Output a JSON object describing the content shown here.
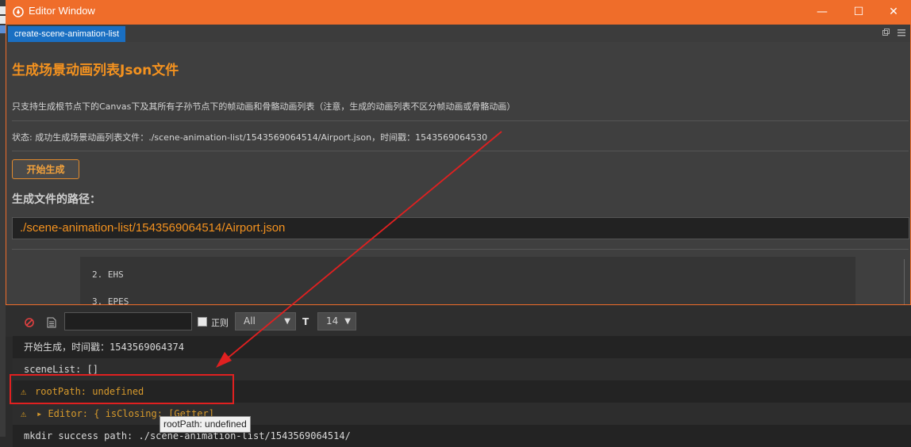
{
  "window": {
    "title": "Editor Window",
    "minimize_label": "—",
    "maximize_label": "☐",
    "close_label": "✕"
  },
  "tabs": {
    "active": "create-scene-animation-list"
  },
  "panel": {
    "heading": "生成场景动画列表Json文件",
    "description": "只支持生成根节点下的Canvas下及其所有子孙节点下的帧动画和骨骼动画列表（注意，生成的动画列表不区分帧动画或骨骼动画）",
    "status": "状态: 成功生成场景动画列表文件：./scene-animation-list/1543569064514/Airport.json，时间戳：1543569064530",
    "generate_button": "开始生成",
    "path_label": "生成文件的路径：",
    "path_value": "./scene-animation-list/1543569064514/Airport.json",
    "code_lines": [
      "2. EHS",
      "3. EPES"
    ]
  },
  "console": {
    "filter_placeholder": "",
    "regex_label": "正则",
    "level_value": "All",
    "font_icon": "T",
    "size_value": "14",
    "logs": [
      {
        "type": "log",
        "text": "开始生成，时间戳：1543569064374"
      },
      {
        "type": "log",
        "text": "sceneList: []"
      },
      {
        "type": "warn",
        "text": "rootPath: undefined"
      },
      {
        "type": "warn",
        "text": "▸ Editor: { isClosing: [Getter]"
      },
      {
        "type": "log",
        "text": "mkdir success path: ./scene-animation-list/1543569064514/"
      }
    ],
    "tooltip": "rootPath: undefined"
  },
  "colors": {
    "title_bar": "#ef6d2a",
    "accent_orange": "#f4921f",
    "tab_active": "#1a6fc2",
    "annotation_red": "#e02020"
  }
}
